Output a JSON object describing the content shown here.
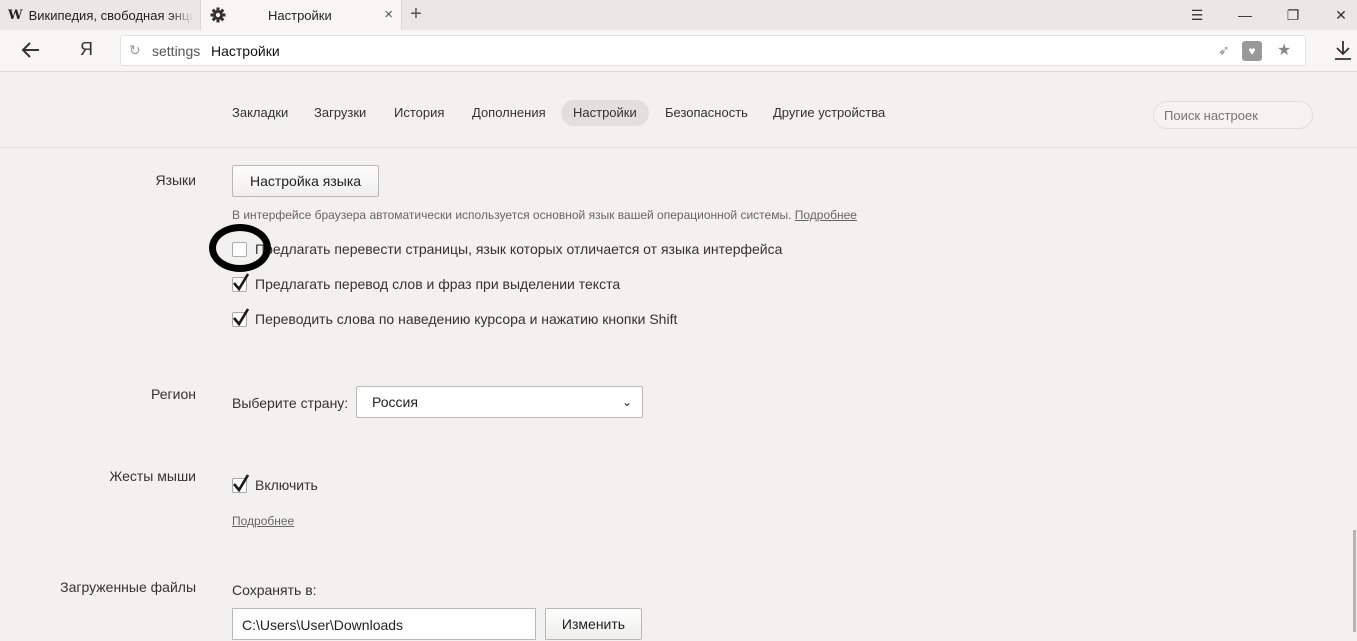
{
  "tabs": [
    {
      "title": "Википедия, свободная энциклопедия",
      "icon": "wikipedia-logo-icon",
      "logo": "W"
    },
    {
      "title": "Настройки",
      "icon": "gear-icon",
      "close": "×",
      "active": true
    }
  ],
  "newtab": "+",
  "window_controls": {
    "menu": "☰",
    "minimize": "—",
    "maximize": "❐",
    "close": "✕"
  },
  "address": {
    "yandex_logo": "Я",
    "protocol": "settings",
    "title": "Настройки"
  },
  "settings_nav": {
    "items": [
      "Закладки",
      "Загрузки",
      "История",
      "Дополнения",
      "Настройки",
      "Безопасность",
      "Другие устройства"
    ],
    "active": "Настройки",
    "search_placeholder": "Поиск настроек"
  },
  "languages": {
    "label": "Языки",
    "button": "Настройка языка",
    "hint": "В интерфейсе браузера автоматически используется основной язык вашей операционной системы.",
    "hint_link": "Подробнее",
    "options": [
      {
        "label": "Предлагать перевести страницы, язык которых отличается от языка интерфейса",
        "checked": false
      },
      {
        "label": "Предлагать перевод слов и фраз при выделении текста",
        "checked": true
      },
      {
        "label": "Переводить слова по наведению курсора и нажатию кнопки Shift",
        "checked": true
      }
    ]
  },
  "region": {
    "label": "Регион",
    "country_label": "Выберите страну:",
    "country_value": "Россия"
  },
  "mouse_gestures": {
    "label": "Жесты мыши",
    "enable_label": "Включить",
    "enabled": true,
    "more_link": "Подробнее"
  },
  "downloads": {
    "label": "Загруженные файлы",
    "save_to_label": "Сохранять в:",
    "path": "C:\\Users\\User\\Downloads",
    "change_button": "Изменить"
  }
}
